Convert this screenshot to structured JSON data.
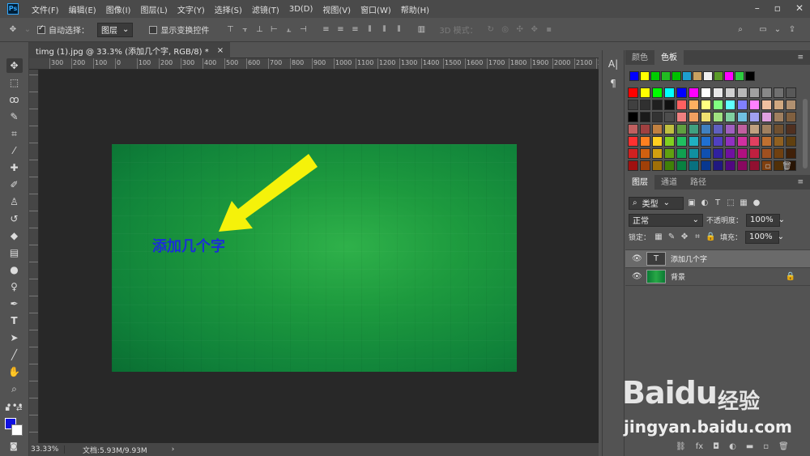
{
  "app": {
    "logo": "Ps"
  },
  "menu": [
    "文件(F)",
    "编辑(E)",
    "图像(I)",
    "图层(L)",
    "文字(Y)",
    "选择(S)",
    "滤镜(T)",
    "3D(D)",
    "视图(V)",
    "窗口(W)",
    "帮助(H)"
  ],
  "options": {
    "auto_select_label": "自动选择：",
    "auto_select_value": "图层",
    "show_transform_label": "显示变换控件",
    "mode_3d_label": "3D 模式："
  },
  "document": {
    "tab_title": "timg (1).jpg @ 33.3% (添加几个字, RGB/8) *",
    "close": "×",
    "canvas_text": "添加几个字",
    "ruler_ticks": [
      "300",
      "200",
      "100",
      "0",
      "100",
      "200",
      "300",
      "400",
      "500",
      "600",
      "700",
      "800",
      "900",
      "1000",
      "1100",
      "1200",
      "1300",
      "1400",
      "1500",
      "1600",
      "1700",
      "1800",
      "1900",
      "2000",
      "2100",
      "2200"
    ]
  },
  "status": {
    "zoom": "33.33%",
    "doc_info": "文档:5.93M/9.93M",
    "arrow": "›"
  },
  "swatches_panel": {
    "tabs": [
      "颜色",
      "色板"
    ],
    "active_tab": "色板",
    "recent": [
      "#0000ff",
      "#ffff00",
      "#00cc00",
      "#22bb22",
      "#00c000",
      "#1e9fd0",
      "#c8a060",
      "#f0f0f0",
      "#5a9a28",
      "#ff00ff",
      "#2ecc40",
      "#000000"
    ],
    "grid": [
      "#ff0000",
      "#ffff00",
      "#00ff00",
      "#00ffff",
      "#0000ff",
      "#ff00ff",
      "#ffffff",
      "#e8e8e8",
      "#d0d0d0",
      "#b8b8b8",
      "#a0a0a0",
      "#888888",
      "#707070",
      "#585858",
      "#404040",
      "#303030",
      "#202020",
      "#101010",
      "#ff6060",
      "#ffb060",
      "#ffff80",
      "#80ff80",
      "#60ffff",
      "#8080ff",
      "#ff80ff",
      "#f0c0a0",
      "#d0a880",
      "#b09070",
      "#000000",
      "#1a1a1a",
      "#333333",
      "#4d4d4d",
      "#f08080",
      "#f0a060",
      "#f0e070",
      "#a0e080",
      "#80d0a0",
      "#70c0e0",
      "#a0a0f0",
      "#e0a0e0",
      "#a08060",
      "#806040",
      "#c06060",
      "#a04040",
      "#c08040",
      "#c0c040",
      "#60a040",
      "#40a080",
      "#4080c0",
      "#6060c0",
      "#a060c0",
      "#c060a0",
      "#c0a080",
      "#a08060",
      "#705030",
      "#503020",
      "#ff3030",
      "#ff8020",
      "#ffd020",
      "#80d020",
      "#20c060",
      "#20b0c0",
      "#2070d0",
      "#5040c0",
      "#9030c0",
      "#d030a0",
      "#e04060",
      "#c07030",
      "#906020",
      "#604010",
      "#d02020",
      "#d06010",
      "#d0a010",
      "#60a010",
      "#10a050",
      "#1090a0",
      "#1050b0",
      "#3020a0",
      "#7010a0",
      "#b01080",
      "#c02040",
      "#a05020",
      "#704010",
      "#402008",
      "#a01010",
      "#a04008",
      "#a07008",
      "#408008",
      "#088040",
      "#087080",
      "#083890",
      "#201880",
      "#500880",
      "#880860",
      "#901030",
      "#804010",
      "#503008",
      "#281404"
    ],
    "footer_new": "▫",
    "footer_trash": "🗑"
  },
  "layers_panel": {
    "tabs": [
      "图层",
      "通道",
      "路径"
    ],
    "active_tab": "图层",
    "filter_label": "类型",
    "blend_mode": "正常",
    "opacity_label": "不透明度：",
    "opacity_value": "100%",
    "lock_label": "锁定：",
    "fill_label": "填充：",
    "fill_value": "100%",
    "layers": [
      {
        "name": "添加几个字",
        "kind": "text",
        "thumb": "T",
        "selected": true
      },
      {
        "name": "背景",
        "kind": "background",
        "locked": true
      }
    ],
    "footer_icons": [
      "link-icon",
      "fx-icon",
      "mask-icon",
      "adjustment-icon",
      "group-icon",
      "new-layer-icon",
      "trash-icon"
    ],
    "fx": "fx"
  },
  "watermark": {
    "logo": "Bai",
    "paw": "du",
    "cn": "经验",
    "url": "jingyan.baidu.com"
  },
  "colors": {
    "canvas_text": "#1a2fd6",
    "arrow": "#f5f20a",
    "fg": "#1010e0",
    "bg": "#ffffff"
  }
}
